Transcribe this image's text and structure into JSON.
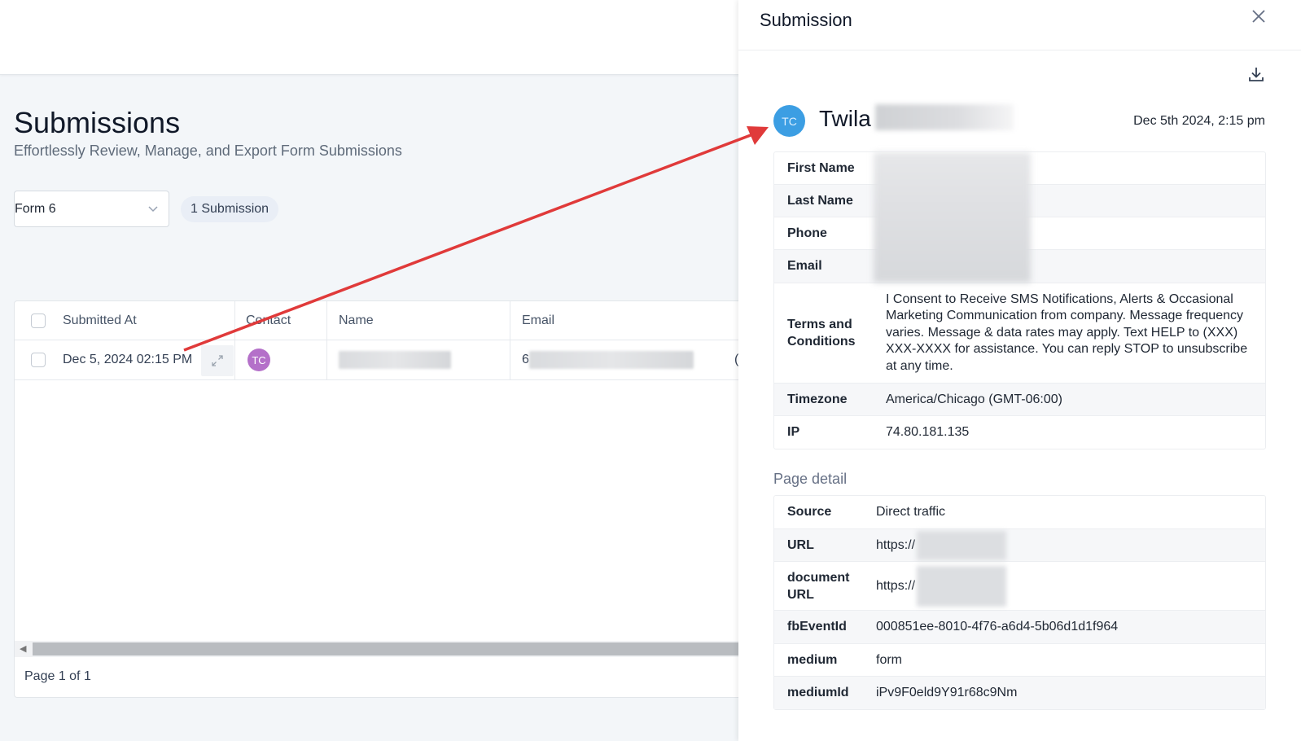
{
  "page": {
    "title": "Submissions",
    "subtitle": "Effortlessly Review, Manage, and Export Form Submissions",
    "form_select_value": "Form 6",
    "submission_count": "1 Submission"
  },
  "table": {
    "headers": [
      "Submitted At",
      "Contact",
      "Name",
      "Email"
    ],
    "row": {
      "submitted_at": "Dec 5, 2024 02:15 PM",
      "contact_initials": "TC",
      "email_prefix": "6",
      "overflow_char": "("
    },
    "pager": "Page 1 of 1"
  },
  "panel": {
    "title": "Submission",
    "contact_initials": "TC",
    "contact_first_name": "Twila",
    "submitted_date": "Dec 5th 2024, 2:15 pm",
    "fields": [
      {
        "key": "First Name",
        "value": ""
      },
      {
        "key": "Last Name",
        "value": ""
      },
      {
        "key": "Phone",
        "value": ""
      },
      {
        "key": "Email",
        "value": ""
      },
      {
        "key": "Terms and Conditions",
        "value": "I Consent to Receive SMS Notifications, Alerts & Occasional Marketing Communication from company. Message frequency varies. Message & data rates may apply. Text HELP to (XXX) XXX-XXXX for assistance. You can reply STOP to unsubscribe at any time."
      },
      {
        "key": "Timezone",
        "value": "America/Chicago (GMT-06:00)"
      },
      {
        "key": "IP",
        "value": "74.80.181.135"
      }
    ],
    "page_detail_heading": "Page detail",
    "page_detail": [
      {
        "key": "Source",
        "value": "Direct traffic"
      },
      {
        "key": "URL",
        "value": "https://"
      },
      {
        "key": "document URL",
        "value": "https://"
      },
      {
        "key": "fbEventId",
        "value": "000851ee-8010-4f76-a6d4-5b06d1d1f964"
      },
      {
        "key": "medium",
        "value": "form"
      },
      {
        "key": "mediumId",
        "value": "iPv9F0eld9Y91r68c9Nm"
      }
    ]
  },
  "icons": {
    "close": "close-icon",
    "download": "download-icon",
    "expand": "expand-icon",
    "chevron": "chevron-down-icon"
  },
  "colors": {
    "annotation_arrow": "#e03a3a",
    "avatar_small": "#b470c9",
    "avatar_large": "#3c9ee3"
  }
}
